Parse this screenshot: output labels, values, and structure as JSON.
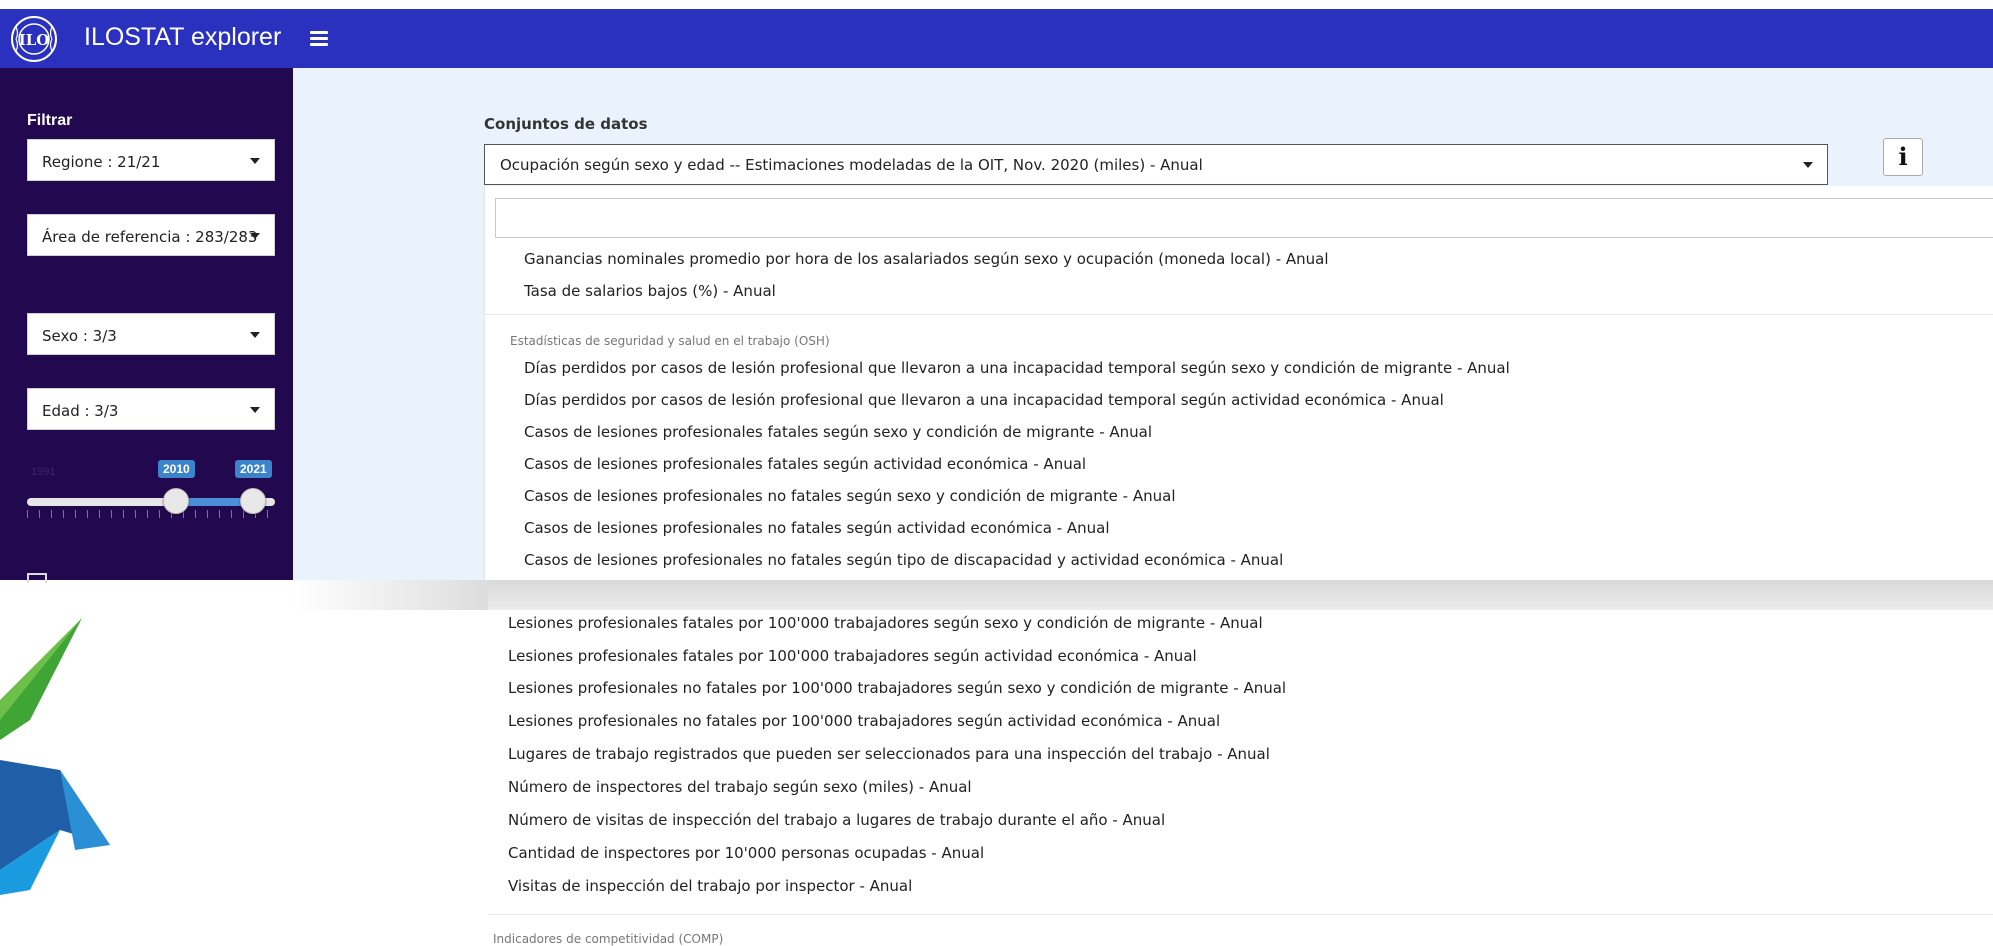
{
  "header": {
    "app_title": "ILOSTAT explorer",
    "colors": {
      "header_bg": "#2a31bf",
      "sidebar_bg": "#22084e",
      "main_bg": "#eaf3fc"
    }
  },
  "sidebar": {
    "filter_title": "Filtrar",
    "filters": [
      {
        "label": "Regione : 21/21"
      },
      {
        "label": "Área de referencia : 283/283"
      },
      {
        "label": "Sexo : 3/3"
      },
      {
        "label": "Edad : 3/3"
      }
    ],
    "slider": {
      "min_label": "1991",
      "from": "2010",
      "to": "2021"
    }
  },
  "main": {
    "datasets_label": "Conjuntos de datos",
    "selected_dataset": "Ocupación según sexo y edad -- Estimaciones modeladas de la OIT, Nov. 2020 (miles) - Anual",
    "info_icon": "info-icon",
    "dropdown": {
      "search_value": "",
      "items_top": [
        "Ganancias nominales promedio por hora de los asalariados según sexo y ocupación (moneda local) - Anual",
        "Tasa de salarios bajos (%) - Anual"
      ],
      "group_osh": "Estadísticas de seguridad y salud en el trabajo (OSH)",
      "items_osh": [
        "Días perdidos por casos de lesión profesional que llevaron a una incapacidad temporal según sexo y condición de migrante - Anual",
        "Días perdidos por casos de lesión profesional que llevaron a una incapacidad temporal según actividad económica - Anual",
        "Casos de lesiones profesionales fatales según sexo y condición de migrante - Anual",
        "Casos de lesiones profesionales fatales según actividad económica - Anual",
        "Casos de lesiones profesionales no fatales según sexo y condición de migrante - Anual",
        "Casos de lesiones profesionales no fatales según actividad económica - Anual",
        "Casos de lesiones profesionales no fatales según tipo de discapacidad y actividad económica - Anual"
      ]
    }
  },
  "lower_list": {
    "items": [
      "Lesiones profesionales fatales por 100'000 trabajadores según sexo y condición de migrante - Anual",
      "Lesiones profesionales fatales por 100'000 trabajadores según actividad económica - Anual",
      "Lesiones profesionales no fatales por 100'000 trabajadores según sexo y condición de migrante - Anual",
      "Lesiones profesionales no fatales por 100'000 trabajadores según actividad económica - Anual",
      "Lugares de trabajo registrados que pueden ser seleccionados para una inspección del trabajo - Anual",
      "Número de inspectores del trabajo según sexo (miles) - Anual",
      "Número de visitas de inspección del trabajo a lugares de trabajo durante el año - Anual",
      "Cantidad de inspectores por 10'000 personas ocupadas - Anual",
      "Visitas de inspección del trabajo por inspector - Anual"
    ],
    "next_group": "Indicadores de competitividad (COMP)"
  }
}
